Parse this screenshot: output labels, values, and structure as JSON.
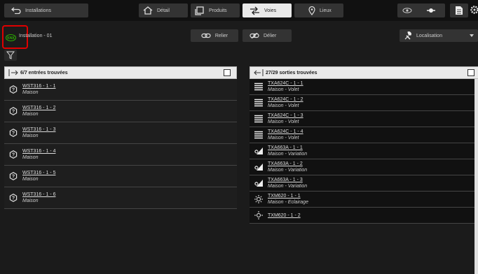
{
  "topbar": {
    "installations_label": "Installations",
    "detail_label": "Détail",
    "produits_label": "Produits",
    "voies_label": "Voies",
    "lieux_label": "Lieux"
  },
  "toolbar": {
    "knx_badge": "KNX",
    "installation_name": "Installation - 01",
    "relier_label": "Relier",
    "delier_label": "Délier",
    "localisation_label": "Localisation"
  },
  "inputs_panel": {
    "title": "6/7 entrées trouvées",
    "items": [
      {
        "name": "WST316 - 1 - 1",
        "location": "Maison"
      },
      {
        "name": "WST316 - 1 - 2",
        "location": "Maison"
      },
      {
        "name": "WST316 - 1 - 3",
        "location": "Maison"
      },
      {
        "name": "WST316 - 1 - 4",
        "location": "Maison"
      },
      {
        "name": "WST316 - 1 - 5",
        "location": "Maison"
      },
      {
        "name": "WST316 - 1 - 6",
        "location": "Maison"
      }
    ]
  },
  "outputs_panel": {
    "title": "27/29 sorties trouvées",
    "items": [
      {
        "name": "TXA624C - 1 - 1",
        "location": "Maison - Volet",
        "icon": "shutter-icon"
      },
      {
        "name": "TXA624C - 1 - 2",
        "location": "Maison - Volet",
        "icon": "shutter-icon"
      },
      {
        "name": "TXA624C - 1 - 3",
        "location": "Maison - Volet",
        "icon": "shutter-icon"
      },
      {
        "name": "TXA624C - 1 - 4",
        "location": "Maison - Volet",
        "icon": "shutter-icon"
      },
      {
        "name": "TXA663A - 1 - 1",
        "location": "Maison - Variation",
        "icon": "dimmer-icon"
      },
      {
        "name": "TXA663A - 1 - 2",
        "location": "Maison - Variation",
        "icon": "dimmer-icon"
      },
      {
        "name": "TXA663A - 1 - 3",
        "location": "Maison - Variation",
        "icon": "dimmer-icon"
      },
      {
        "name": "TXM620 - 1 - 1",
        "location": "Maison - Eclairage",
        "icon": "light-icon"
      },
      {
        "name": "TXM620 - 1 - 2",
        "location": "",
        "icon": "light-icon"
      }
    ]
  },
  "colors": {
    "highlight": "#e00000",
    "knx_green": "#2db300"
  }
}
